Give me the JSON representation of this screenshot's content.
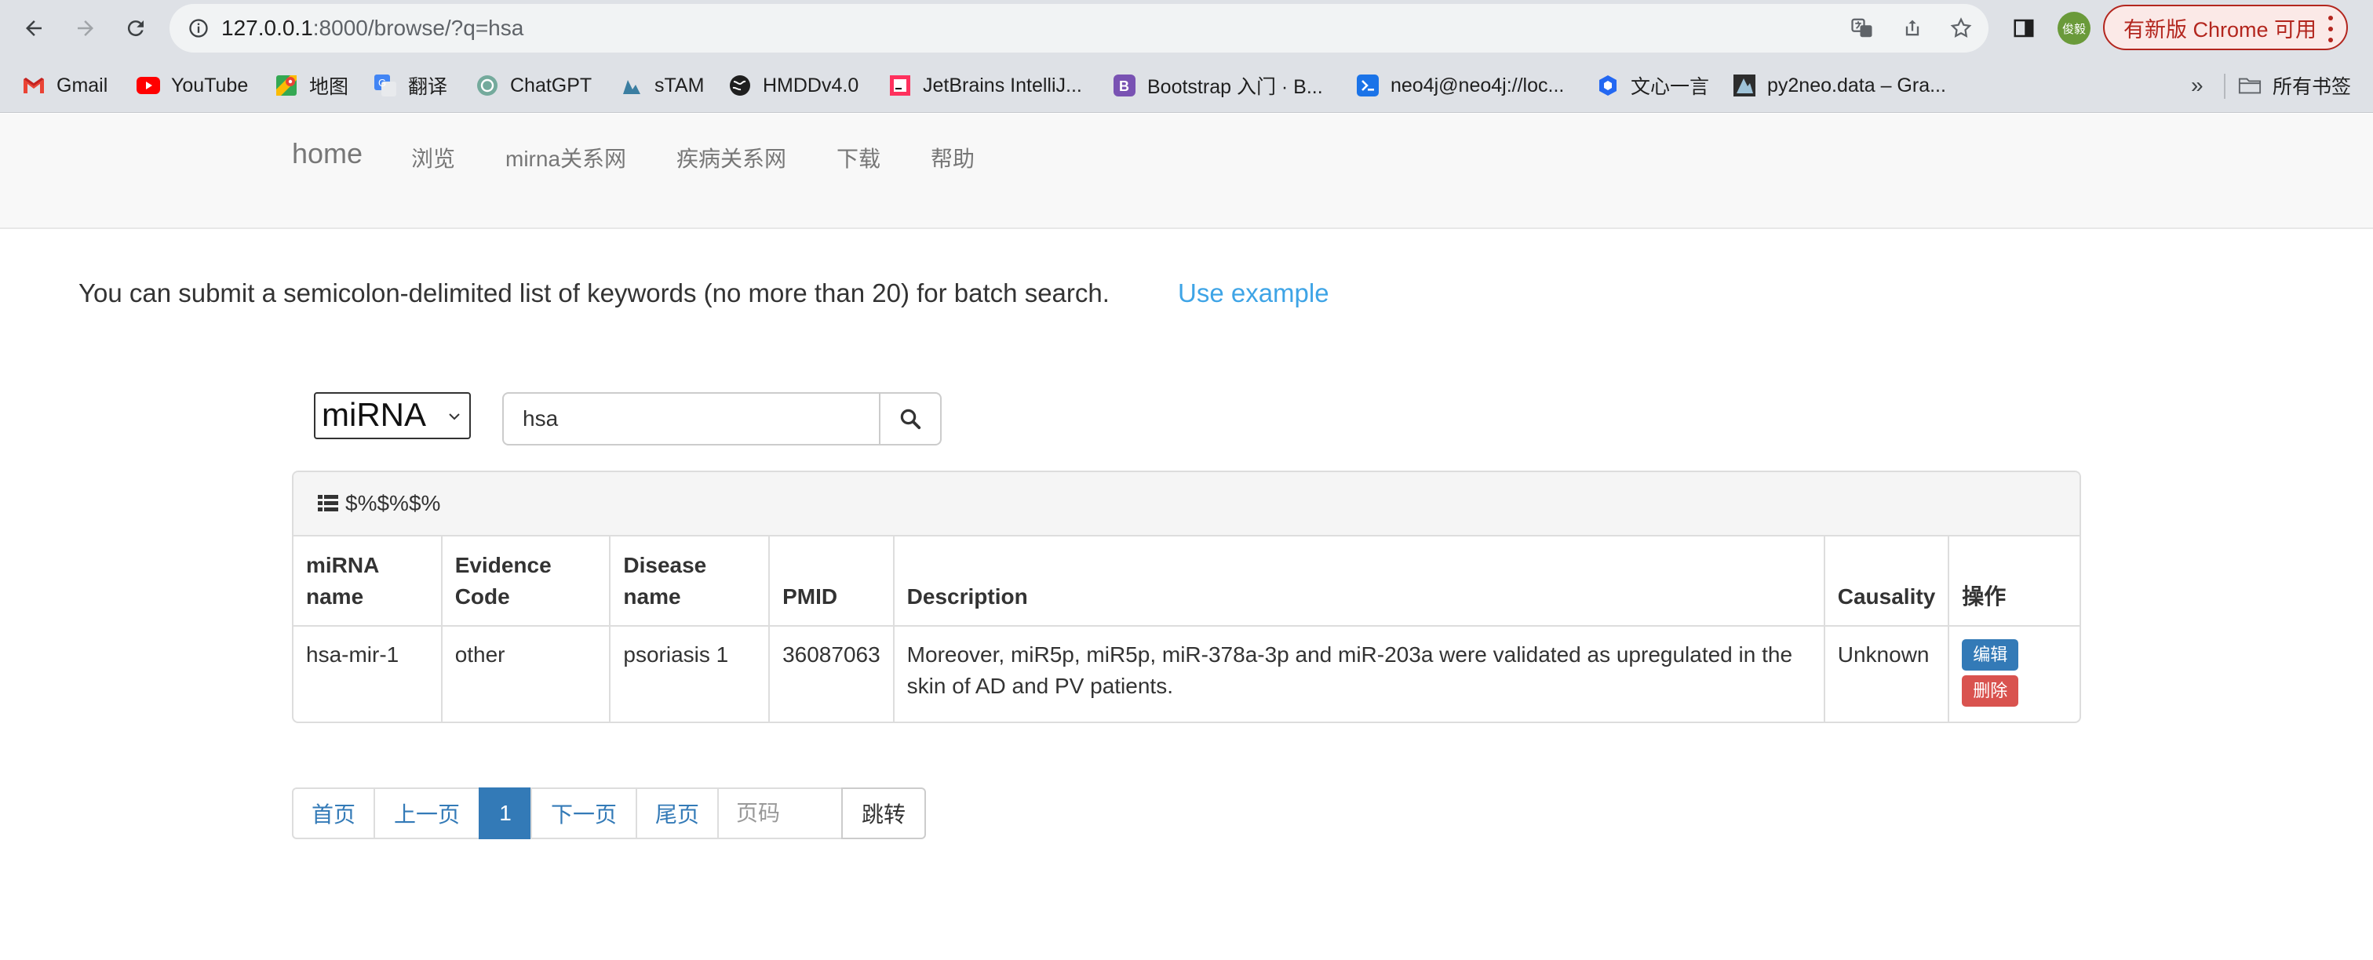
{
  "browser": {
    "url_host": "127.0.0.1",
    "url_rest": ":8000/browse/?q=hsa",
    "profile_badge": "俊毅",
    "update_label": "有新版 Chrome 可用"
  },
  "bookmarks": {
    "items": [
      {
        "label": "Gmail",
        "icon": "gmail-icon"
      },
      {
        "label": "YouTube",
        "icon": "youtube-icon"
      },
      {
        "label": "地图",
        "icon": "maps-icon"
      },
      {
        "label": "翻译",
        "icon": "translate-icon"
      },
      {
        "label": "ChatGPT",
        "icon": "chatgpt-icon"
      },
      {
        "label": "sTAM",
        "icon": "stam-icon"
      },
      {
        "label": "HMDDv4.0",
        "icon": "globe-icon"
      },
      {
        "label": "JetBrains IntelliJ...",
        "icon": "jetbrains-icon"
      },
      {
        "label": "Bootstrap 入门 · B...",
        "icon": "bootstrap-icon"
      },
      {
        "label": "neo4j@neo4j://loc...",
        "icon": "terminal-icon"
      },
      {
        "label": "文心一言",
        "icon": "wenxin-icon"
      },
      {
        "label": "py2neo.data – Gra...",
        "icon": "py2neo-icon"
      }
    ],
    "overflow": "»",
    "all_bookmarks": "所有书签"
  },
  "site_nav": {
    "brand": "home",
    "links": [
      "浏览",
      "mirna关系网",
      "疾病关系网",
      "下载",
      "帮助"
    ]
  },
  "intro": {
    "text": "You can submit a semicolon-delimited list of keywords (no more than 20) for batch search.",
    "example_link": "Use example"
  },
  "search": {
    "type_selected": "miRNA",
    "query": "hsa"
  },
  "panel": {
    "title": "$%$%$%"
  },
  "table": {
    "headers": [
      "miRNA name",
      "Evidence Code",
      "Disease name",
      "PMID",
      "Description",
      "Causality",
      "操作"
    ],
    "rows": [
      {
        "mirna": "hsa-mir-1",
        "evidence": "other",
        "disease": "psoriasis 1",
        "pmid": "36087063",
        "description": "Moreover, miR5p, miR5p, miR-378a-3p and miR-203a were validated as upregulated in the skin of AD and PV patients.",
        "causality": "Unknown",
        "edit_label": "编辑",
        "delete_label": "删除"
      }
    ]
  },
  "pagination": {
    "first": "首页",
    "prev": "上一页",
    "current": "1",
    "next": "下一页",
    "last": "尾页",
    "page_placeholder": "页码",
    "go": "跳转"
  },
  "colors": {
    "link": "#3ea4e6",
    "primary": "#337ab7",
    "danger": "#d9534f",
    "update_red": "#b3261e"
  }
}
